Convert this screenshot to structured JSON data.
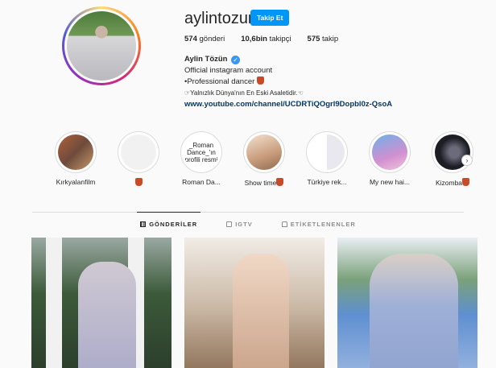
{
  "profile": {
    "username": "aylintozun",
    "follow_label": "Takip Et",
    "stats": [
      {
        "num": "574",
        "label": "gönderi"
      },
      {
        "num": "10,6bin",
        "label": "takipçi"
      },
      {
        "num": "575",
        "label": "takip"
      }
    ],
    "name": "Aylin Tözün",
    "bio_line1": "Official instagram account",
    "bio_line2": "•Professional dancer",
    "bio_line3": "☞Yalnızlık Dünya'nın En Eski Asaletidir.☜",
    "link": "www.youtube.com/channel/UCDRTiQOgrl9Dopbl0z-QsoA"
  },
  "highlights": [
    {
      "label": "Kırkyalanfilm"
    },
    {
      "label": ""
    },
    {
      "label": "Roman Da...",
      "thumb_text": "_Roman Dance_'ın profili resmi"
    },
    {
      "label": "Show time"
    },
    {
      "label": "Türkiye rek..."
    },
    {
      "label": "My new hai..."
    },
    {
      "label": "Kizomba"
    }
  ],
  "tabs": [
    {
      "label": "GÖNDERİLER",
      "icon": "grid-icon",
      "active": true
    },
    {
      "label": "IGTV",
      "icon": "tv-icon",
      "active": false
    },
    {
      "label": "ETİKETLENENLER",
      "icon": "tag-icon",
      "active": false
    }
  ],
  "colors": {
    "accent": "#0095f6",
    "link": "#00376b",
    "border": "#dbdbdb",
    "muted": "#8e8e8e"
  }
}
